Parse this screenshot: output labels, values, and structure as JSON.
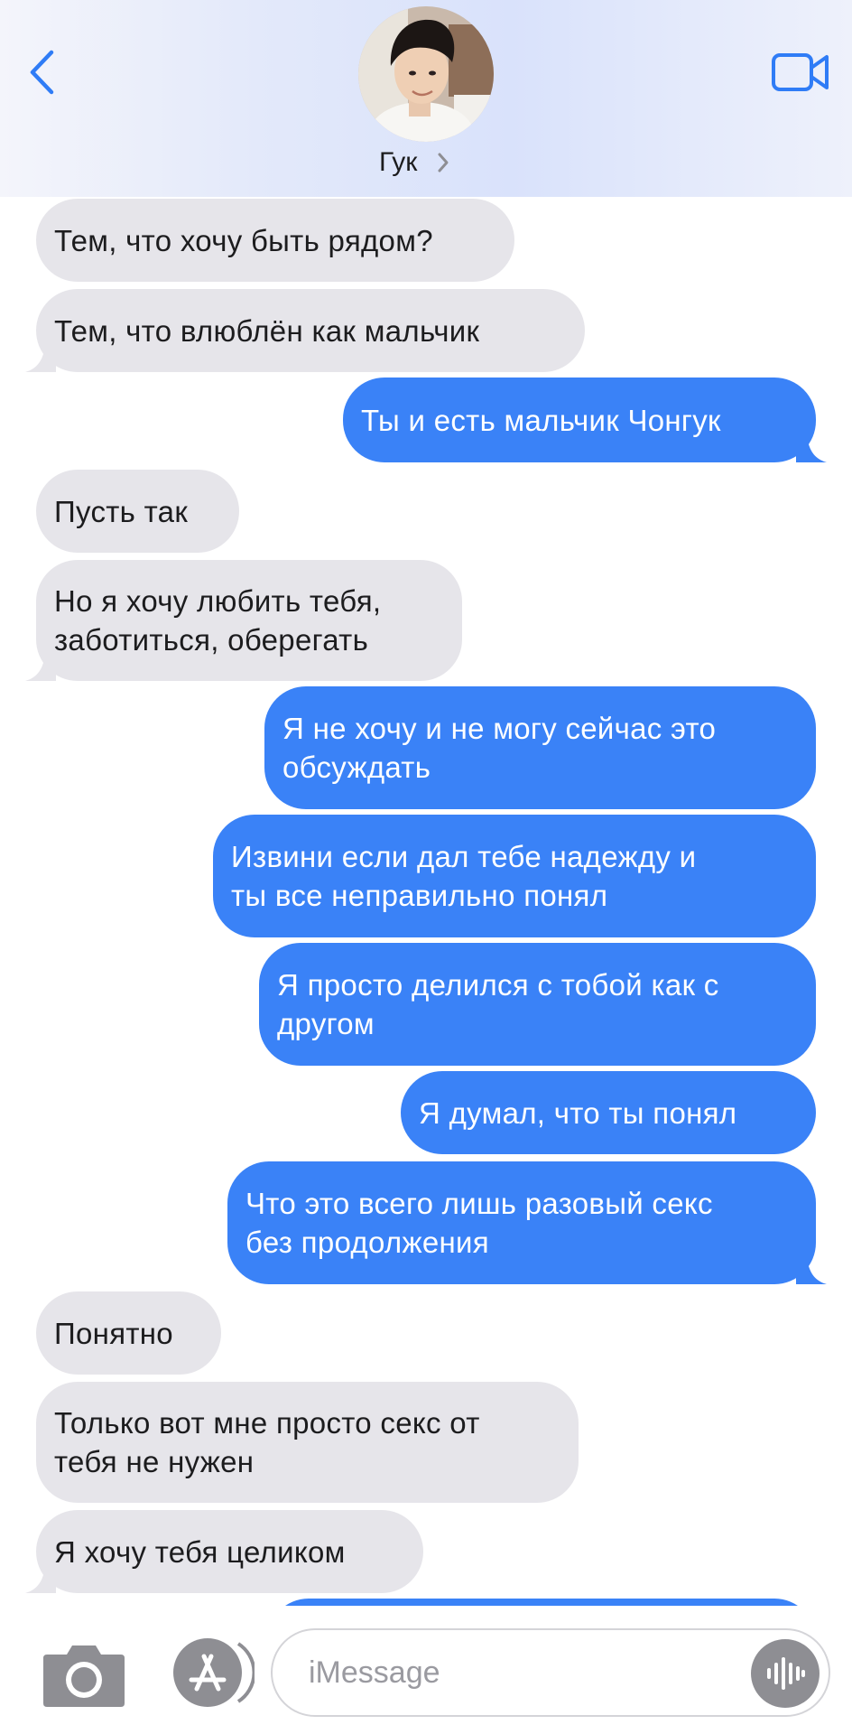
{
  "header": {
    "contact_name": "Гук",
    "back_icon": "chevron-left-icon",
    "video_icon": "video-camera-icon"
  },
  "colors": {
    "incoming_bubble": "#e6e5ea",
    "outgoing_bubble": "#3a82f7",
    "accent": "#2f7cf6"
  },
  "messages": [
    {
      "dir": "in",
      "text": "Тем, что хочу быть рядом?"
    },
    {
      "dir": "in",
      "text": "Тем, что влюблён как мальчик"
    },
    {
      "dir": "out",
      "text": "Ты и есть мальчик Чонгук"
    },
    {
      "dir": "in",
      "text": "Пусть так"
    },
    {
      "dir": "in",
      "text": "Но я хочу любить тебя,\nзаботиться,  оберегать"
    },
    {
      "dir": "out",
      "text": "Я не хочу и не могу сейчас это\nобсуждать"
    },
    {
      "dir": "out",
      "text": "Извини если  дал тебе надежду  и\nты все неправильно понял"
    },
    {
      "dir": "out",
      "text": "Я просто делился с тобой как с\nдругом"
    },
    {
      "dir": "out",
      "text": "Я думал, что ты понял"
    },
    {
      "dir": "out",
      "text": "Что это всего лишь разовый секс\nбез продолжения"
    },
    {
      "dir": "in",
      "text": "Понятно"
    },
    {
      "dir": "in",
      "text": "Только вот мне просто секс от\nтебя не нужен"
    },
    {
      "dir": "in",
      "text": "Я хочу тебя целиком"
    },
    {
      "dir": "out",
      "text": ""
    }
  ],
  "composer": {
    "placeholder": "iMessage",
    "camera_icon": "camera-icon",
    "apps_icon": "app-store-icon",
    "audio_icon": "audio-waveform-icon"
  }
}
